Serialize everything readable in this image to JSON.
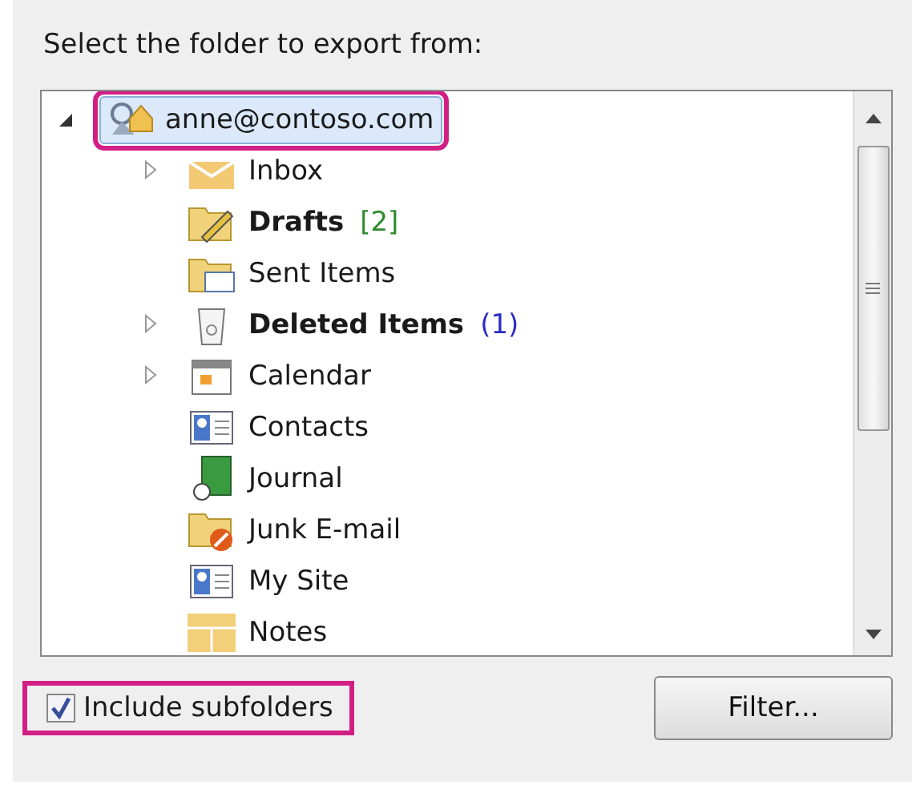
{
  "heading": "Select the folder to export from:",
  "tree": {
    "root": {
      "label": "anne@contoso.com",
      "kind": "account",
      "expanded": true,
      "selected": true,
      "highlighted": true,
      "children": [
        {
          "label": "Inbox",
          "kind": "inbox",
          "has_children": true,
          "expanded": false,
          "bold": false,
          "selected": false
        },
        {
          "label": "Drafts",
          "kind": "drafts",
          "has_children": false,
          "bold": true,
          "count": {
            "text": "[2]",
            "color": "#2e8b2e"
          },
          "selected": false
        },
        {
          "label": "Sent Items",
          "kind": "sent",
          "has_children": false,
          "bold": false,
          "selected": false
        },
        {
          "label": "Deleted Items",
          "kind": "deleted",
          "has_children": true,
          "expanded": false,
          "bold": true,
          "count": {
            "text": "(1)",
            "color": "#2b2bc8"
          },
          "selected": false
        },
        {
          "label": "Calendar",
          "kind": "calendar",
          "has_children": true,
          "expanded": false,
          "bold": false,
          "selected": false
        },
        {
          "label": "Contacts",
          "kind": "contacts",
          "has_children": false,
          "bold": false,
          "selected": false
        },
        {
          "label": "Journal",
          "kind": "journal",
          "has_children": false,
          "bold": false,
          "selected": false
        },
        {
          "label": "Junk E-mail",
          "kind": "junk",
          "has_children": false,
          "bold": false,
          "selected": false
        },
        {
          "label": "My Site",
          "kind": "contacts",
          "has_children": false,
          "bold": false,
          "selected": false
        },
        {
          "label": "Notes",
          "kind": "notes",
          "has_children": false,
          "bold": false,
          "selected": false
        }
      ]
    }
  },
  "include_subfolders": {
    "label": "Include subfolders",
    "checked": true,
    "highlighted": true
  },
  "filter_button": "Filter..."
}
